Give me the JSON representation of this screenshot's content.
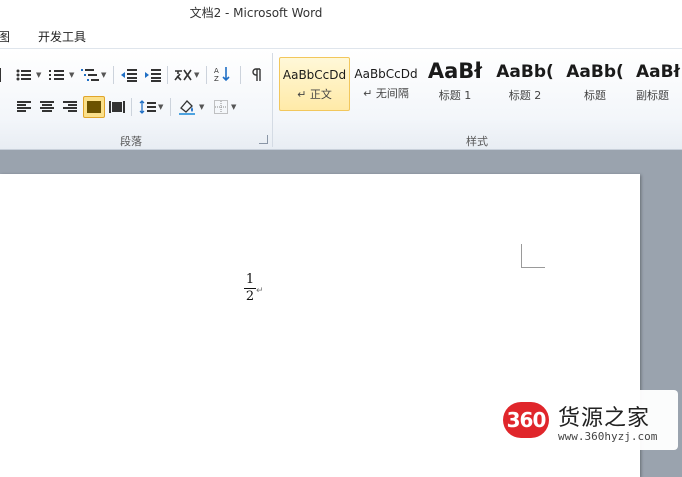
{
  "window": {
    "title": "文档2 - Microsoft Word"
  },
  "tabs": [
    {
      "label": "图"
    },
    {
      "label": "开发工具"
    }
  ],
  "ribbon": {
    "paragraph_group_label": "段落",
    "styles_group_label": "样式",
    "styles": [
      {
        "sample": "AaBbCcDd",
        "name": "↵ 正文",
        "selected": true
      },
      {
        "sample": "AaBbCcDd",
        "name": "↵ 无间隔",
        "selected": false
      },
      {
        "sample": "AaBł",
        "name": "标题 1",
        "selected": false
      },
      {
        "sample": "AaBb(",
        "name": "标题 2",
        "selected": false
      },
      {
        "sample": "AaBb(",
        "name": "标题",
        "selected": false
      },
      {
        "sample": "AaBł",
        "name": "副标题",
        "selected": false
      }
    ]
  },
  "document": {
    "fraction": {
      "numerator": "1",
      "denominator": "2"
    },
    "paragraph_mark": "↵"
  },
  "watermark": {
    "badge": "360",
    "name": "货源之家",
    "url": "www.360hyzj.com"
  },
  "colors": {
    "accent": "#e0262b",
    "ribbon_active": "#fbe08a",
    "doc_background": "#9aa3ae"
  }
}
